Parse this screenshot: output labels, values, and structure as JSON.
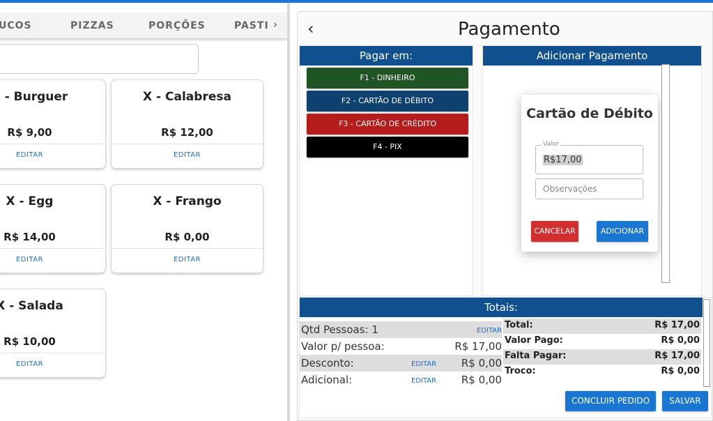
{
  "categories": {
    "items": [
      "UCOS",
      "PIZZAS",
      "PORÇÕES",
      "PASTI"
    ],
    "next_arrow": "›"
  },
  "products": [
    {
      "name": "X - Burguer",
      "price": "R$ 9,00",
      "edit": "EDITAR"
    },
    {
      "name": "X - Calabresa",
      "price": "R$ 12,00",
      "edit": "EDITAR"
    },
    {
      "name": "X - Egg",
      "price": "R$ 14,00",
      "edit": "EDITAR"
    },
    {
      "name": "X - Frango",
      "price": "R$ 0,00",
      "edit": "EDITAR"
    },
    {
      "name": "X - Salada",
      "price": "R$ 10,00",
      "edit": "EDITAR"
    }
  ],
  "payment": {
    "back_icon": "‹",
    "title": "Pagamento",
    "pay_in": {
      "header": "Pagar em:",
      "methods": [
        {
          "label": "F1 - DINHEIRO",
          "color": "#1f5425"
        },
        {
          "label": "F2 - CARTÃO DE DÉBITO",
          "color": "#0e4170"
        },
        {
          "label": "F3 - CARTÃO DE CRÉDITO",
          "color": "#b71c1c"
        },
        {
          "label": "F4 - PIX",
          "color": "#000000"
        }
      ]
    },
    "add_payment": {
      "header": "Adicionar Pagamento",
      "dialog": {
        "title": "Cartão de Débito",
        "value_label": "Valor",
        "value": "R$17,00",
        "notes_placeholder": "Observações",
        "cancel": "CANCELAR",
        "add": "ADICIONAR",
        "cancel_color": "#d32f2f",
        "add_color": "#1976d2"
      }
    },
    "totals": {
      "header": "Totais:",
      "people_label": "Qtd Pessoas: 1",
      "people_edit": "EDITAR",
      "per_person_label": "Valor p/ pessoa:",
      "per_person_value": "R$ 17,00",
      "discount_label": "Desconto:",
      "discount_edit": "EDITAR",
      "discount_value": "R$ 0,00",
      "additional_label": "Adicional:",
      "additional_edit": "EDITAR",
      "additional_value": "R$ 0,00",
      "summary": [
        {
          "label": "Total:",
          "value": "R$ 17,00"
        },
        {
          "label": "Valor Pago:",
          "value": "R$ 0,00"
        },
        {
          "label": "Falta Pagar:",
          "value": "R$ 17,00"
        },
        {
          "label": "Troco:",
          "value": "R$ 0,00"
        }
      ]
    },
    "actions": {
      "conclude": "CONCLUIR PEDIDO",
      "save": "SALVAR"
    }
  }
}
